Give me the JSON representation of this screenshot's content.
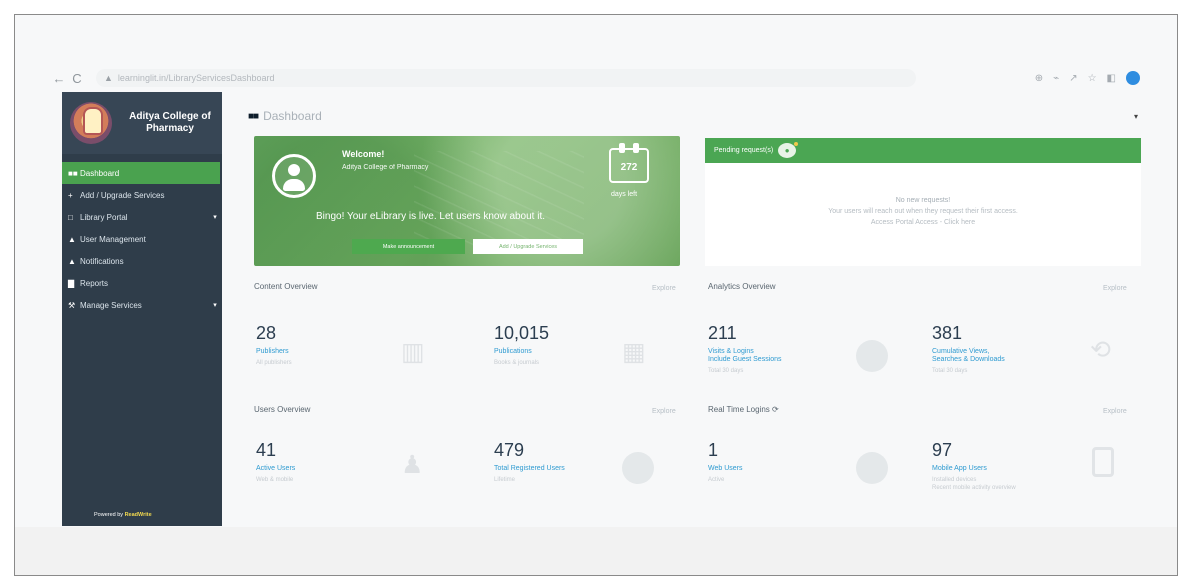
{
  "browser": {
    "url": "learninglit.in/LibraryServicesDashboard",
    "nav_back": "←",
    "nav_reload": "C",
    "lock_icon": "▲",
    "right_icons": [
      "⊕",
      "⌁",
      "↗",
      "☆",
      "◧"
    ]
  },
  "sidebar": {
    "college_name": "Aditya College of Pharmacy",
    "items": [
      {
        "label": "Dashboard",
        "icon": "dashboard-icon",
        "glyph": "■■"
      },
      {
        "label": "Add / Upgrade Services",
        "icon": "plus-icon",
        "glyph": "+"
      },
      {
        "label": "Library Portal",
        "icon": "monitor-icon",
        "glyph": "□"
      },
      {
        "label": "User Management",
        "icon": "user-icon",
        "glyph": "▲"
      },
      {
        "label": "Notifications",
        "icon": "bell-icon",
        "glyph": "▲"
      },
      {
        "label": "Reports",
        "icon": "chart-icon",
        "glyph": "▇"
      },
      {
        "label": "Manage Services",
        "icon": "wrench-icon",
        "glyph": "⚒"
      }
    ],
    "caret": "▾",
    "powered_by": "Powered by",
    "powered_brand": "ReadWrite"
  },
  "main": {
    "title_icon": "■■",
    "title": "Dashboard",
    "top_right_caret": "▾",
    "welcome": {
      "title": "Welcome!",
      "college": "Aditya College of Pharmacy",
      "days": "272",
      "days_label": "days left",
      "message": "Bingo! Your eLibrary is live. Let users know about it.",
      "button_primary": "Make announcement",
      "button_secondary": "Add / Upgrade Services"
    },
    "pending": {
      "title": "Pending request(s)",
      "count_icon": "●",
      "empty": "No new requests!",
      "message": "Your users will reach out when they request their first access.",
      "footer": "Access Portal Access - Click here"
    },
    "content_overview": {
      "title": "Content Overview",
      "explore": "Explore",
      "stats": [
        {
          "value": "28",
          "label": "Publishers",
          "sub": "All publishers"
        },
        {
          "value": "10,015",
          "label": "Publications",
          "sub": "Books & journals"
        }
      ]
    },
    "analytics_overview": {
      "title": "Analytics Overview",
      "explore": "Explore",
      "stats": [
        {
          "value": "211",
          "label": "Visits & Logins",
          "label2": "Include Guest Sessions",
          "sub": "Total 30 days"
        },
        {
          "value": "381",
          "label": "Cumulative Views,",
          "label2": "Searches & Downloads",
          "sub": "Total 30 days"
        }
      ]
    },
    "users_overview": {
      "title": "Users Overview",
      "explore": "Explore",
      "stats": [
        {
          "value": "41",
          "label": "Active Users",
          "sub": "Web & mobile"
        },
        {
          "value": "479",
          "label": "Total Registered Users",
          "sub": "Lifetime"
        }
      ]
    },
    "realtime_logins": {
      "title": "Real Time Logins",
      "refresh_icon": "⟳",
      "explore": "Explore",
      "stats": [
        {
          "value": "1",
          "label": "Web Users",
          "sub": "Active"
        },
        {
          "value": "97",
          "label": "Mobile App Users",
          "sub": "Installed devices",
          "sub2": "Recent mobile activity overview"
        }
      ]
    }
  },
  "colors": {
    "sidebar": "#2f3d4a",
    "active": "#4aa24f",
    "welcome": "#72ad65",
    "pending": "#4ba653",
    "link": "#2f9bd1"
  }
}
